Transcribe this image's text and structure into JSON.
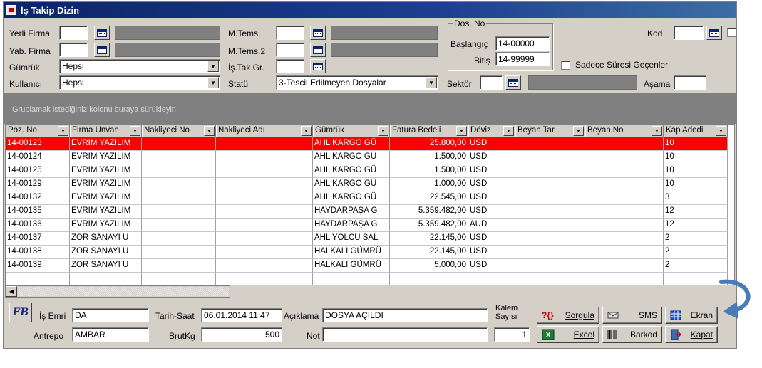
{
  "window": {
    "title": "İş Takip Dizin"
  },
  "filters": {
    "yerli_firma_label": "Yerli Firma",
    "yab_firma_label": "Yab. Firma",
    "gumruk_label": "Gümrük",
    "gumruk_value": "Hepsi",
    "kullanici_label": "Kullanıcı",
    "kullanici_value": "Hepsi",
    "mtems_label": "M.Tems.",
    "mtems2_label": "M.Tems.2",
    "is_tak_gr_label": "İş.Tak.Gr.",
    "statu_label": "Statü",
    "statu_value": "3-Tescil Edilmeyen Dosyalar",
    "dos_no_title": "Dos. No",
    "baslangic_label": "Başlangıç",
    "baslangic_value": "14-00000",
    "bitis_label": "Bitiş",
    "bitis_value": "14-99999",
    "sadece_label": "Sadece Süresi Geçenler",
    "kod_label": "Kod",
    "sektor_label": "Sektör",
    "asama_label": "Aşama"
  },
  "grouping_hint": "Gruplamak istediğiniz kolonu buraya sürükleyin",
  "grid": {
    "columns": [
      "Poz. No",
      "Firma Unvan",
      "Nakliyeci No",
      "Nakliyeci Adı",
      "Gümrük",
      "Fatura Bedeli",
      "Döviz",
      "Beyan.Tar.",
      "Beyan.No",
      "Kap Adedi"
    ],
    "rows": [
      [
        "14-00123",
        "EVRIM YAZILIM",
        "",
        "",
        "AHL KARGO GÜ",
        "25.800,00",
        "USD",
        "",
        "",
        "10"
      ],
      [
        "14-00124",
        "EVRIM YAZILIM",
        "",
        "",
        "AHL KARGO GÜ",
        "1.500,00",
        "USD",
        "",
        "",
        "10"
      ],
      [
        "14-00125",
        "EVRIM YAZILIM",
        "",
        "",
        "AHL KARGO GÜ",
        "1.500,00",
        "USD",
        "",
        "",
        "10"
      ],
      [
        "14-00129",
        "EVRIM YAZILIM",
        "",
        "",
        "AHL KARGO GÜ",
        "1.000,00",
        "USD",
        "",
        "",
        "10"
      ],
      [
        "14-00132",
        "EVRIM YAZILIM",
        "",
        "",
        "AHL KARGO GÜ",
        "22.545,00",
        "USD",
        "",
        "",
        "3"
      ],
      [
        "14-00135",
        "EVRIM YAZILIM",
        "",
        "",
        "HAYDARPAŞA G",
        "5.359.482,00",
        "USD",
        "",
        "",
        "12"
      ],
      [
        "14-00136",
        "EVRIM YAZILIM",
        "",
        "",
        "HAYDARPAŞA G",
        "5.359.482,00",
        "AUD",
        "",
        "",
        "12"
      ],
      [
        "14-00137",
        "ZOR SANAYI U",
        "",
        "",
        "AHL YOLCU SAL",
        "22.145,00",
        "USD",
        "",
        "",
        "2"
      ],
      [
        "14-00138",
        "ZOR SANAYI U",
        "",
        "",
        "HALKALI GÜMRÜ",
        "22.145,00",
        "USD",
        "",
        "",
        "2"
      ],
      [
        "14-00139",
        "ZOR SANAYI U",
        "",
        "",
        "HALKALI GÜMRÜ",
        "5.000,00",
        "USD",
        "",
        "",
        "2"
      ]
    ],
    "selected_row": 0
  },
  "bottom": {
    "logo_text": "EB",
    "is_emri_label": "İş Emri",
    "is_emri_value": "DA",
    "antrepo_label": "Antrepo",
    "antrepo_value": "AMBAR",
    "tarih_saat_label": "Tarih-Saat",
    "tarih_saat_value": "06.01.2014 11:47",
    "brutkg_label": "BrutKg",
    "brutkg_value": "500",
    "aciklama_label": "Açıklama",
    "aciklama_value": "DOSYA AÇILDI",
    "not_label": "Not",
    "kalem_label_1": "Kalem",
    "kalem_label_2": "Sayısı",
    "kalem_value": "1"
  },
  "buttons": {
    "sorgula": "Sorgula",
    "sms": "SMS",
    "ekran": "Ekran",
    "excel": "Excel",
    "barkod": "Barkod",
    "kapat": "Kapat"
  },
  "colors": {
    "title_bar": "#0a246a",
    "selected_row": "#ff0000",
    "annotation_arrow": "#4a7ab8"
  }
}
